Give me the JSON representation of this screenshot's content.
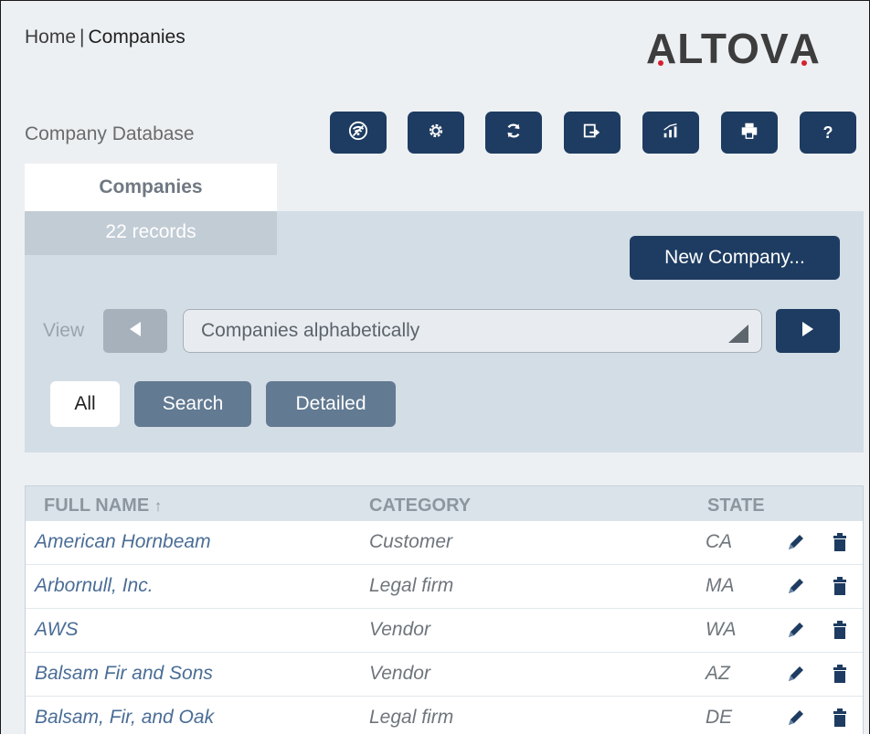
{
  "breadcrumb": {
    "home": "Home",
    "separator": "|",
    "current": "Companies"
  },
  "logo": {
    "text": "ALTOVA",
    "accent_color": "#d6202f"
  },
  "database_label": "Company Database",
  "toolbar": {
    "buttons": [
      {
        "icon": "wifi-off-icon",
        "label": ""
      },
      {
        "icon": "gear-icon",
        "label": ""
      },
      {
        "icon": "refresh-icon",
        "label": ""
      },
      {
        "icon": "export-icon",
        "label": ""
      },
      {
        "icon": "chart-icon",
        "label": ""
      },
      {
        "icon": "print-icon",
        "label": ""
      },
      {
        "icon": "help-icon",
        "label": "?"
      }
    ]
  },
  "tab": {
    "label": "Companies",
    "records": "22 records"
  },
  "new_company_label": "New Company...",
  "view": {
    "label": "View",
    "selected": "Companies alphabetically"
  },
  "filters": {
    "all": "All",
    "search": "Search",
    "detailed": "Detailed"
  },
  "table": {
    "headers": {
      "name": "FULL NAME",
      "sort": "↑",
      "category": "CATEGORY",
      "state": "STATE"
    },
    "rows": [
      {
        "name": "American Hornbeam",
        "category": "Customer",
        "state": "CA"
      },
      {
        "name": "Arbornull, Inc.",
        "category": "Legal firm",
        "state": "MA"
      },
      {
        "name": "AWS",
        "category": "Vendor",
        "state": "WA"
      },
      {
        "name": "Balsam Fir and Sons",
        "category": "Vendor",
        "state": "AZ"
      },
      {
        "name": "Balsam, Fir, and Oak",
        "category": "Legal firm",
        "state": "DE"
      }
    ]
  },
  "colors": {
    "primary": "#1e3c61",
    "secondary": "#627a92",
    "panel": "#d3dde6",
    "link": "#4a6d96"
  }
}
